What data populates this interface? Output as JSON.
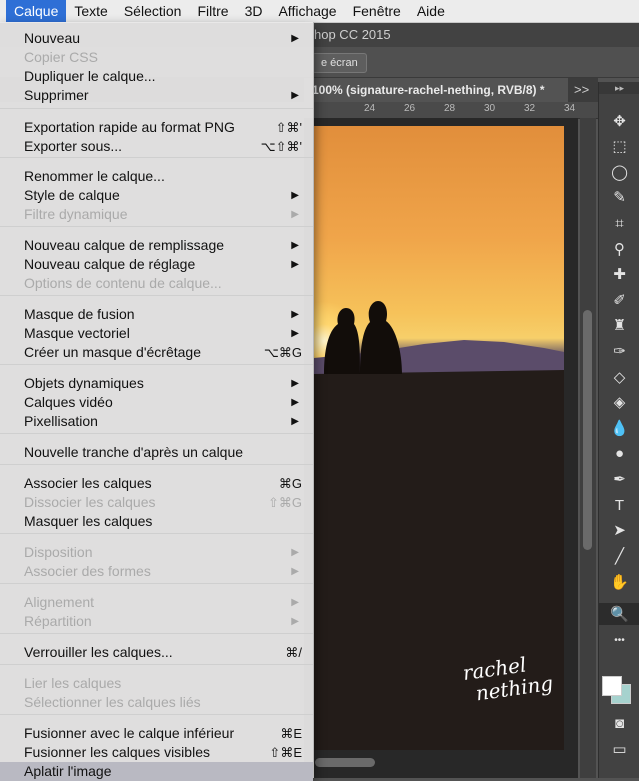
{
  "menubar": {
    "items": [
      {
        "label": "Calque",
        "active": true
      },
      {
        "label": "Texte"
      },
      {
        "label": "Sélection"
      },
      {
        "label": "Filtre"
      },
      {
        "label": "3D"
      },
      {
        "label": "Affichage"
      },
      {
        "label": "Fenêtre"
      },
      {
        "label": "Aide"
      }
    ]
  },
  "app": {
    "title_fragment": "hop CC 2015",
    "fullscreen_label": "e écran",
    "document_tab": "100% (signature-rachel-nething, RVB/8) *",
    "tab_overflow": ">>",
    "ruler_ticks": [
      "24",
      "26",
      "28",
      "30",
      "32",
      "34"
    ],
    "signature_line1": "rachel",
    "signature_line2": "nething"
  },
  "calque_menu": {
    "items": [
      {
        "label": "Nouveau",
        "enabled": true,
        "submenu": true
      },
      {
        "label": "Copier CSS",
        "enabled": false
      },
      {
        "label": "Dupliquer le calque...",
        "enabled": true
      },
      {
        "label": "Supprimer",
        "enabled": true,
        "submenu": true
      },
      {
        "label": "Exportation rapide au format PNG",
        "enabled": true,
        "shortcut": "⇧⌘'"
      },
      {
        "label": "Exporter sous...",
        "enabled": true,
        "shortcut": "⌥⇧⌘'"
      },
      {
        "label": "Renommer le calque...",
        "enabled": true
      },
      {
        "label": "Style de calque",
        "enabled": true,
        "submenu": true
      },
      {
        "label": "Filtre dynamique",
        "enabled": false,
        "submenu": true
      },
      {
        "label": "Nouveau calque de remplissage",
        "enabled": true,
        "submenu": true
      },
      {
        "label": "Nouveau calque de réglage",
        "enabled": true,
        "submenu": true
      },
      {
        "label": "Options de contenu de calque...",
        "enabled": false
      },
      {
        "label": "Masque de fusion",
        "enabled": true,
        "submenu": true
      },
      {
        "label": "Masque vectoriel",
        "enabled": true,
        "submenu": true
      },
      {
        "label": "Créer un masque d'écrêtage",
        "enabled": true,
        "shortcut": "⌥⌘G"
      },
      {
        "label": "Objets dynamiques",
        "enabled": true,
        "submenu": true
      },
      {
        "label": "Calques vidéo",
        "enabled": true,
        "submenu": true
      },
      {
        "label": "Pixellisation",
        "enabled": true,
        "submenu": true
      },
      {
        "label": "Nouvelle tranche d'après un calque",
        "enabled": true
      },
      {
        "label": "Associer les calques",
        "enabled": true,
        "shortcut": "⌘G"
      },
      {
        "label": "Dissocier les calques",
        "enabled": false,
        "shortcut": "⇧⌘G"
      },
      {
        "label": "Masquer les calques",
        "enabled": true
      },
      {
        "label": "Disposition",
        "enabled": false,
        "submenu": true
      },
      {
        "label": "Associer des formes",
        "enabled": false,
        "submenu": true
      },
      {
        "label": "Alignement",
        "enabled": false,
        "submenu": true
      },
      {
        "label": "Répartition",
        "enabled": false,
        "submenu": true
      },
      {
        "label": "Verrouiller les calques...",
        "enabled": true,
        "shortcut": "⌘/"
      },
      {
        "label": "Lier les calques",
        "enabled": false
      },
      {
        "label": "Sélectionner les calques liés",
        "enabled": false
      },
      {
        "label": "Fusionner avec le calque inférieur",
        "enabled": true,
        "shortcut": "⌘E"
      },
      {
        "label": "Fusionner les calques visibles",
        "enabled": true,
        "shortcut": "⇧⌘E"
      },
      {
        "label": "Aplatir l'image",
        "enabled": true,
        "highlighted": true
      }
    ]
  },
  "tools": [
    {
      "name": "move-tool-icon",
      "glyph": "✥"
    },
    {
      "name": "marquee-tool-icon",
      "glyph": "⬚"
    },
    {
      "name": "lasso-tool-icon",
      "glyph": "◯"
    },
    {
      "name": "quick-selection-tool-icon",
      "glyph": "✎"
    },
    {
      "name": "crop-tool-icon",
      "glyph": "⌗"
    },
    {
      "name": "eyedropper-tool-icon",
      "glyph": "⚲"
    },
    {
      "name": "healing-brush-tool-icon",
      "glyph": "✚"
    },
    {
      "name": "brush-tool-icon",
      "glyph": "✐"
    },
    {
      "name": "clone-stamp-tool-icon",
      "glyph": "♜"
    },
    {
      "name": "history-brush-tool-icon",
      "glyph": "✑"
    },
    {
      "name": "eraser-tool-icon",
      "glyph": "◇"
    },
    {
      "name": "paint-bucket-tool-icon",
      "glyph": "◈"
    },
    {
      "name": "blur-tool-icon",
      "glyph": "💧"
    },
    {
      "name": "dodge-tool-icon",
      "glyph": "●"
    },
    {
      "name": "pen-tool-icon",
      "glyph": "✒"
    },
    {
      "name": "type-tool-icon",
      "glyph": "T"
    },
    {
      "name": "path-selection-tool-icon",
      "glyph": "➤"
    },
    {
      "name": "line-tool-icon",
      "glyph": "╱"
    },
    {
      "name": "hand-tool-icon",
      "glyph": "✋"
    },
    {
      "name": "zoom-tool-icon",
      "glyph": "🔍",
      "selected": true
    },
    {
      "name": "more-tools-icon",
      "glyph": "•••"
    }
  ],
  "colors": {
    "menu_highlight": "#2e6fd6",
    "foreground_swatch": "#ffffff",
    "background_swatch": "#a6d2ce"
  }
}
